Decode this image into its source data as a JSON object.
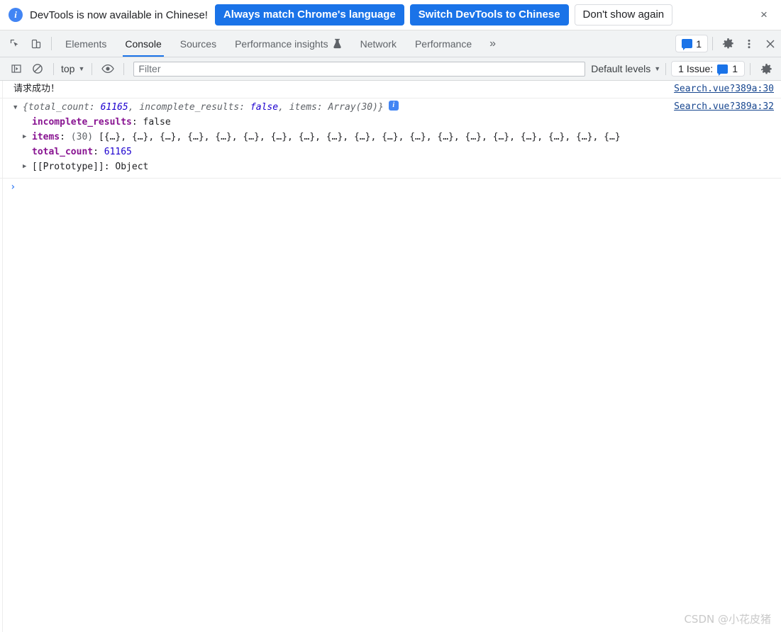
{
  "notification": {
    "info_icon": "info-icon",
    "message": "DevTools is now available in Chinese!",
    "primary_button": "Always match Chrome's language",
    "secondary_button": "Switch DevTools to Chinese",
    "dismiss_button": "Don't show again",
    "close_icon": "×",
    "primary_color": "#1a73e8"
  },
  "tabbar": {
    "inspect_icon": "inspect-element-icon",
    "device_icon": "device-toolbar-icon",
    "tabs": [
      {
        "label": "Elements",
        "active": false
      },
      {
        "label": "Console",
        "active": true
      },
      {
        "label": "Sources",
        "active": false
      },
      {
        "label": "Performance insights",
        "active": false,
        "icon": "flask-icon"
      },
      {
        "label": "Network",
        "active": false
      },
      {
        "label": "Performance",
        "active": false
      }
    ],
    "more_tabs_icon": "»",
    "issues_count": "1",
    "issues_icon": "message-badge-icon",
    "settings_icon": "gear-icon",
    "more_options_icon": "kebab-menu-icon",
    "close_icon": "×",
    "active_underline_color": "#1a73e8"
  },
  "console_toolbar": {
    "sidebar_toggle_icon": "console-sidebar-icon",
    "clear_console_icon": "clear-console-icon",
    "context_label": "top",
    "context_caret": "▼",
    "eye_icon": "live-expression-eye-icon",
    "filter_placeholder": "Filter",
    "filter_value": "",
    "levels_label": "Default levels",
    "levels_caret": "▼",
    "issues_label": "1 Issue:",
    "issues_count": "1",
    "settings_icon": "gear-icon"
  },
  "console": {
    "messages": [
      {
        "text": "请求成功！",
        "source": "Search.vue?389a:30"
      }
    ],
    "object_message": {
      "source": "Search.vue?389a:32",
      "expander": "▼",
      "preview_open": "{",
      "preview": [
        {
          "key": "total_count",
          "sep": ": ",
          "value": "61165",
          "type": "number",
          "after": ", "
        },
        {
          "key": "incomplete_results",
          "sep": ": ",
          "value": "false",
          "type": "boolean",
          "after": ", "
        },
        {
          "key": "items",
          "sep": ": ",
          "value": "Array(30)",
          "type": "array",
          "after": ""
        }
      ],
      "preview_close": "}",
      "info_badge": "i",
      "children": [
        {
          "expandable": false,
          "key": "incomplete_results",
          "sep": ": ",
          "value": "false",
          "type": "boolean"
        },
        {
          "expandable": true,
          "expander": "▶",
          "key": "items",
          "sep": ": ",
          "count": "(30)",
          "value": "[{…}, {…}, {…}, {…}, {…}, {…}, {…}, {…}, {…}, {…}, {…}, {…}, {…}, {…}, {…}, {…}, {…}, {…}, {…}",
          "type": "array-preview"
        },
        {
          "expandable": false,
          "key": "total_count",
          "sep": ": ",
          "value": "61165",
          "type": "number"
        },
        {
          "expandable": true,
          "expander": "▶",
          "key": "",
          "sep": "",
          "value": "[[Prototype]]: Object",
          "type": "prototype"
        }
      ]
    },
    "prompt_chevron": "›"
  },
  "watermark": {
    "text": "CSDN @小花皮猪"
  }
}
